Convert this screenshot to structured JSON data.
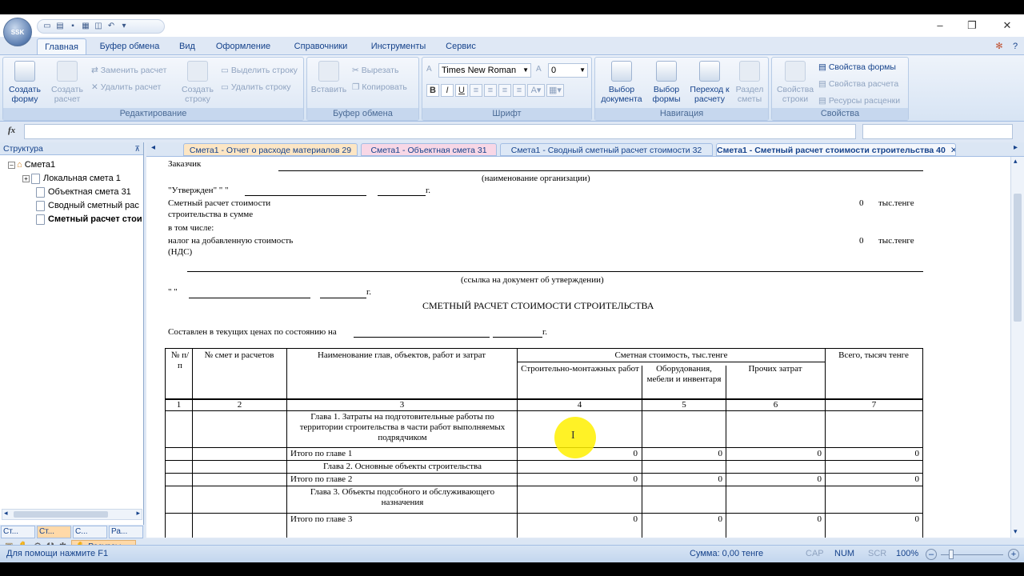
{
  "app": {
    "logo": "SSK"
  },
  "ribbon_tabs": [
    "Главная",
    "Буфер обмена",
    "Вид",
    "Оформление",
    "Справочники",
    "Инструменты",
    "Сервис"
  ],
  "ribbon": {
    "edit": {
      "title": "Редактирование",
      "create_form": "Создать форму",
      "create_calc": "Создать расчет",
      "replace_calc": "Заменить расчет",
      "delete_calc": "Удалить расчет",
      "create_row": "Создать строку",
      "select_row": "Выделить строку",
      "delete_row": "Удалить строку"
    },
    "clipboard": {
      "title": "Буфер обмена",
      "paste": "Вставить",
      "cut": "Вырезать",
      "copy": "Копировать"
    },
    "font": {
      "title": "Шрифт",
      "name": "Times New Roman",
      "size": "0",
      "bold": "B",
      "italic": "I",
      "underline": "U"
    },
    "nav": {
      "title": "Навигация",
      "choose_doc": "Выбор документа",
      "choose_form": "Выбор формы",
      "goto_calc": "Переход к расчету",
      "sections": "Раздел сметы"
    },
    "props": {
      "title": "Свойства",
      "row_props": "Свойства строки",
      "form_props": "Свойства формы",
      "calc_props": "Свойства расчета",
      "res_props": "Ресурсы расценки"
    }
  },
  "formula": {
    "fx": "fx"
  },
  "left_panel": {
    "title": "Структура",
    "tree": [
      "Смета1",
      "Локальная смета 1",
      "Объектная смета 31",
      "Сводный сметный рас",
      "Сметный расчет стои"
    ],
    "bottom_tabs": [
      "Ст...",
      "Ст...",
      "С...",
      "Ра..."
    ],
    "resources": "Ресурсы"
  },
  "doc_tabs": [
    "Смета1 - Отчет о расходе материалов 29",
    "Смета1 - Объектная смета 31",
    "Смета1 - Сводный сметный расчет стоимости 32",
    "Смета1 - Сметный расчет стоимости строительства 40"
  ],
  "doc": {
    "customer": "Заказчик",
    "org_caption": "(наименование организации)",
    "approved": "\"Утвержден\" \"     \"",
    "year": "г.",
    "cost_label_1": "Сметный расчет стоимости",
    "cost_label_2": "строительства в сумме",
    "incl": "в том числе:",
    "vat_1": "налог на добавленную стоимость",
    "vat_2": "(НДС)",
    "zero": "0",
    "unit": "тыс.тенге",
    "ref_caption": "(ссылка на документ об утверждении)",
    "quote": "\"     \"",
    "heading": "СМЕТНЫЙ РАСЧЕТ СТОИМОСТИ СТРОИТЕЛЬСТВА",
    "compiled": "Составлен в текущих ценах по состоянию на",
    "table_headers": {
      "no": "№ п/п",
      "calc_no": "№ смет и расчетов",
      "name": "Наименование глав, объектов, работ и затрат",
      "cost": "Сметная стоимость, тыс.тенге",
      "smr": "Строительно-монтажных работ",
      "equip": "Оборудования, мебели и инвентаря",
      "other": "Прочих затрат",
      "total": "Всего, тысяч тенге"
    },
    "col_numbers": [
      "1",
      "2",
      "3",
      "4",
      "5",
      "6",
      "7"
    ],
    "rows": [
      {
        "name": "Глава 1. Затраты на подготовительные работы по территории строительства в части работ выполняемых подрядчиком"
      },
      {
        "name": "Итого по главе 1",
        "v": [
          "0",
          "0",
          "0",
          "0"
        ]
      },
      {
        "name": "Глава 2. Основные объекты строительства"
      },
      {
        "name": "Итого по главе 2",
        "v": [
          "0",
          "0",
          "0",
          "0"
        ]
      },
      {
        "name": "Глава 3. Объекты подсобного и обслуживающего назначения"
      },
      {
        "name": "Итого по главе 3",
        "v": [
          "0",
          "0",
          "0",
          "0"
        ]
      }
    ]
  },
  "status": {
    "help": "Для помощи нажмите F1",
    "sum": "Сумма: 0,00 тенге",
    "cap": "CAP",
    "num": "NUM",
    "scr": "SCR",
    "zoom": "100%"
  }
}
